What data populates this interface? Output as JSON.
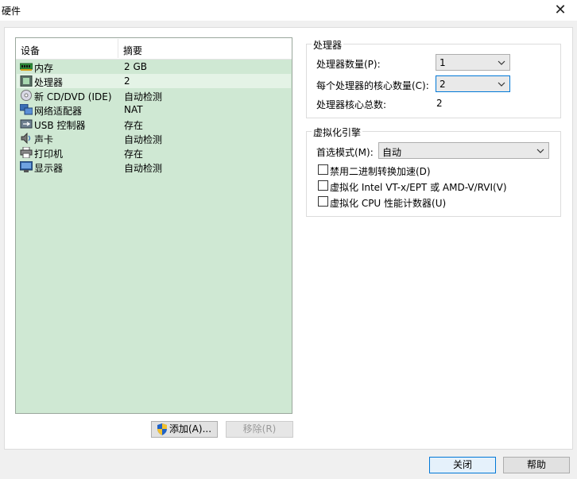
{
  "window": {
    "title": "硬件"
  },
  "device_list": {
    "headers": {
      "device": "设备",
      "summary": "摘要"
    },
    "rows": [
      {
        "name": "内存",
        "summary": "2 GB",
        "icon": "memory-icon"
      },
      {
        "name": "处理器",
        "summary": "2",
        "icon": "processor-icon",
        "selected": true
      },
      {
        "name": "新 CD/DVD (IDE)",
        "summary": "自动检测",
        "icon": "cd-dvd-icon"
      },
      {
        "name": "网络适配器",
        "summary": "NAT",
        "icon": "network-adapter-icon"
      },
      {
        "name": "USB 控制器",
        "summary": "存在",
        "icon": "usb-icon"
      },
      {
        "name": "声卡",
        "summary": "自动检测",
        "icon": "sound-card-icon"
      },
      {
        "name": "打印机",
        "summary": "存在",
        "icon": "printer-icon"
      },
      {
        "name": "显示器",
        "summary": "自动检测",
        "icon": "display-icon"
      }
    ]
  },
  "buttons": {
    "add": "添加(A)...",
    "remove": "移除(R)",
    "close": "关闭",
    "help": "帮助"
  },
  "processor": {
    "group_title": "处理器",
    "count_label": "处理器数量(P):",
    "count_value": "1",
    "cores_label": "每个处理器的核心数量(C):",
    "cores_value": "2",
    "total_label": "处理器核心总数:",
    "total_value": "2"
  },
  "virtualization": {
    "group_title": "虚拟化引擎",
    "mode_label": "首选模式(M):",
    "mode_value": "自动",
    "options": [
      {
        "label": "禁用二进制转换加速(D)",
        "checked": false
      },
      {
        "label": "虚拟化 Intel VT-x/EPT 或 AMD-V/RVI(V)",
        "checked": false
      },
      {
        "label": "虚拟化 CPU 性能计数器(U)",
        "checked": false
      }
    ]
  },
  "colors": {
    "list_bg": "#cfe8d3",
    "selected_row": "#e4f3e6",
    "primary_border": "#0078d7"
  }
}
